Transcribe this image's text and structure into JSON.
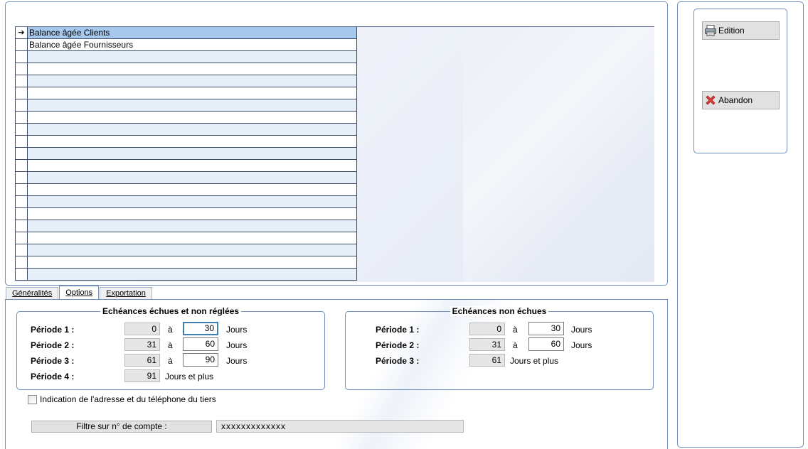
{
  "grid": {
    "current_row_marker": "➔",
    "rows": [
      "Balance âgée Clients",
      "Balance âgée Fournisseurs",
      "",
      "",
      "",
      "",
      "",
      "",
      "",
      "",
      "",
      "",
      "",
      "",
      "",
      "",
      "",
      "",
      "",
      "",
      ""
    ]
  },
  "tabs": [
    "Généralités",
    "Options",
    "Exportation"
  ],
  "active_tab": "Options",
  "groups": {
    "overdue": {
      "title": "Echéances échues et non réglées",
      "periods": [
        {
          "label": "Période 1 :",
          "from": "0",
          "sep": "à",
          "to": "30",
          "unit": "Jours"
        },
        {
          "label": "Période 2 :",
          "from": "31",
          "sep": "à",
          "to": "60",
          "unit": "Jours"
        },
        {
          "label": "Période 3 :",
          "from": "61",
          "sep": "à",
          "to": "90",
          "unit": "Jours"
        },
        {
          "label": "Période 4 :",
          "from": "91",
          "unit": "Jours et plus"
        }
      ]
    },
    "not_due": {
      "title": "Echéances non échues",
      "periods": [
        {
          "label": "Période 1 :",
          "from": "0",
          "sep": "à",
          "to": "30",
          "unit": "Jours"
        },
        {
          "label": "Période 2 :",
          "from": "31",
          "sep": "à",
          "to": "60",
          "unit": "Jours"
        },
        {
          "label": "Période 3 :",
          "from": "61",
          "unit": "Jours et plus"
        }
      ]
    }
  },
  "address_option": {
    "label": "Indication de l'adresse et du téléphone du tiers",
    "checked": false
  },
  "filter": {
    "label": "Filtre sur n° de compte :",
    "value": "xxxxxxxxxxxxx"
  },
  "buttons": {
    "edition": "Edition",
    "abandon": "Abandon"
  },
  "icons": {
    "edition": "printer-icon",
    "abandon": "red-x-icon"
  },
  "colors": {
    "selected_row": "#a6c8ec",
    "alt_row": "#e6eef8",
    "border": "#6d8fc0",
    "focus": "#3c7fb1"
  }
}
